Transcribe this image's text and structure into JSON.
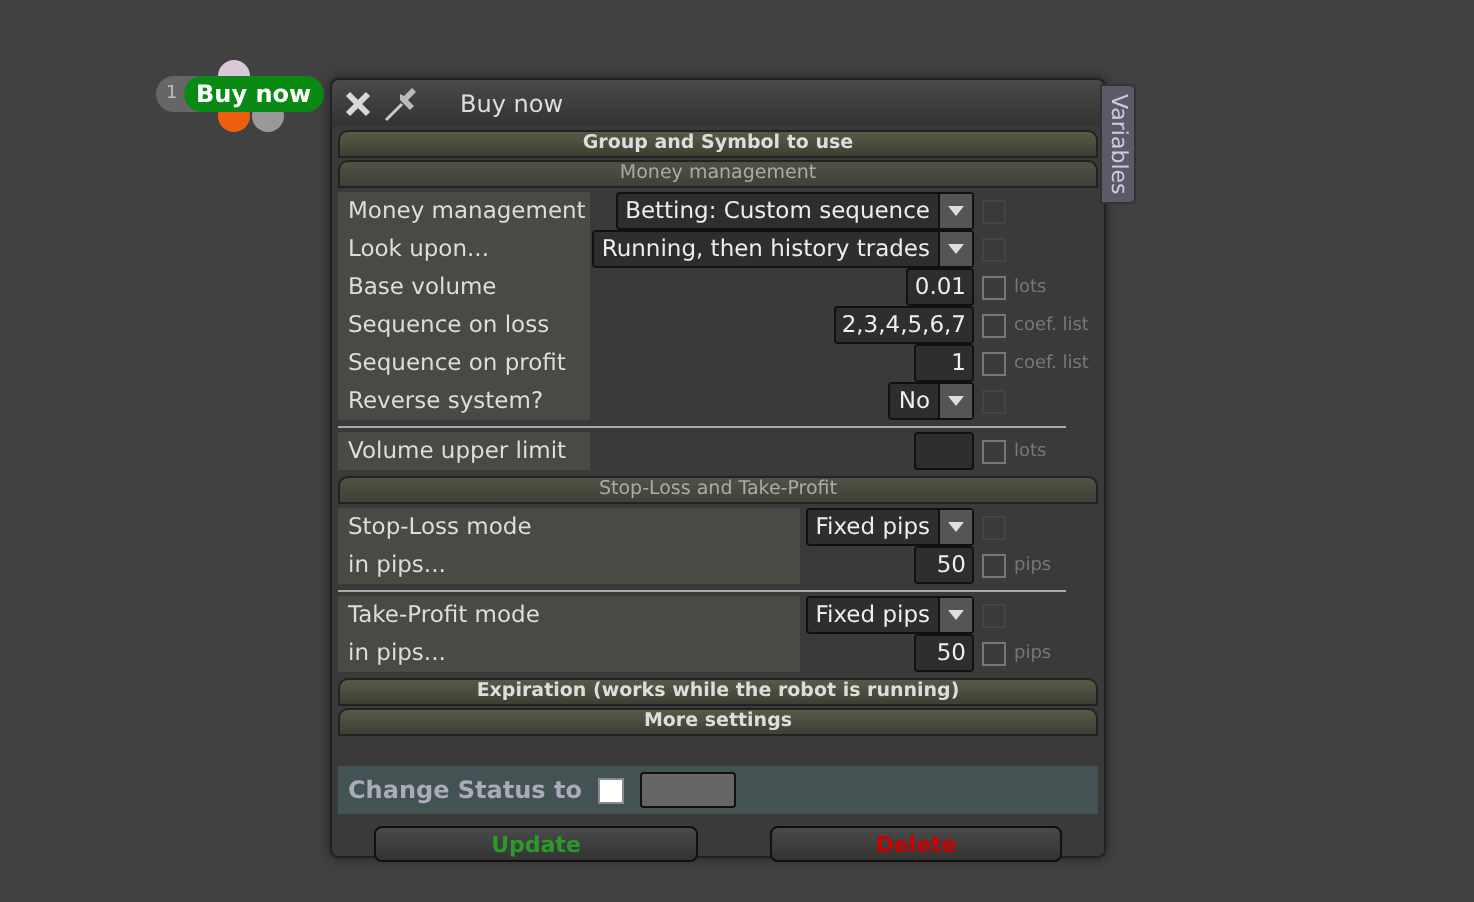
{
  "node": {
    "number": "1",
    "label": "Buy now"
  },
  "window": {
    "title": "Buy now",
    "side_tab": "Variables"
  },
  "sections": [
    {
      "title": "Group and Symbol to use",
      "kind": "header"
    },
    {
      "title": "Money management",
      "kind": "subheader",
      "label_wide": false,
      "groups": [
        [
          {
            "label": "Money management",
            "kind": "dropdown",
            "value": "Betting: Custom sequence",
            "checked": false
          },
          {
            "label": "Look upon...",
            "kind": "dropdown",
            "value": "Running, then history trades",
            "checked": false
          },
          {
            "label": "Base volume",
            "kind": "number",
            "value": "0.01",
            "checked": false,
            "unit": "lots"
          },
          {
            "label": "Sequence on loss",
            "kind": "number",
            "value": "2,3,4,5,6,7",
            "checked": false,
            "unit": "coef. list"
          },
          {
            "label": "Sequence on profit",
            "kind": "number",
            "value": "1",
            "checked": false,
            "unit": "coef. list"
          },
          {
            "label": "Reverse system?",
            "kind": "dropdown",
            "value": "No",
            "checked": false
          }
        ],
        [
          {
            "label": "Volume upper limit",
            "kind": "number",
            "checked": false,
            "unit": "lots"
          }
        ]
      ]
    },
    {
      "title": "Stop-Loss and Take-Profit",
      "kind": "subheader",
      "label_wide": true,
      "groups": [
        [
          {
            "label": "Stop-Loss mode",
            "kind": "dropdown",
            "value": "Fixed pips",
            "checked": false
          },
          {
            "label": "in pips...",
            "kind": "number",
            "value": "50",
            "checked": false,
            "unit": "pips"
          }
        ],
        [
          {
            "label": "Take-Profit mode",
            "kind": "dropdown",
            "value": "Fixed pips",
            "checked": false
          },
          {
            "label": "in pips...",
            "kind": "number",
            "value": "50",
            "checked": false,
            "unit": "pips"
          }
        ]
      ]
    },
    {
      "title": "Expiration (works while the robot is running)",
      "kind": "header"
    },
    {
      "title": "More settings",
      "kind": "header"
    }
  ],
  "status": {
    "label": "Change Status to",
    "checked": false
  },
  "buttons": [
    {
      "label": "Update",
      "kind": "update"
    },
    {
      "label": "Delete",
      "kind": "delete"
    }
  ]
}
